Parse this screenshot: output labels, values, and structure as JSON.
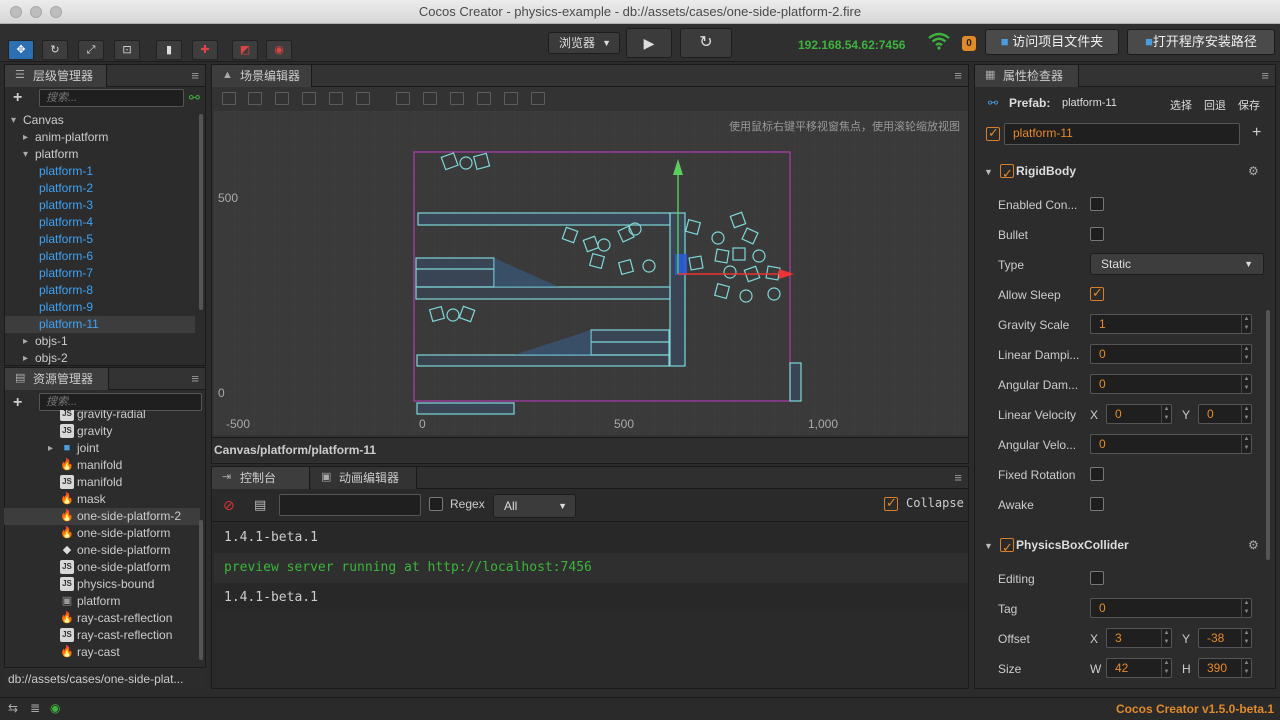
{
  "window": {
    "title": "Cocos Creator - physics-example - db://assets/cases/one-side-platform-2.fire"
  },
  "toolbar": {
    "browser_label": "浏览器",
    "ip": "192.168.54.62:7456",
    "badge": "0",
    "open_project_folder": "访问项目文件夹",
    "open_install_path": "打开程序安装路径"
  },
  "hierarchy": {
    "title": "层级管理器",
    "search_placeholder": "搜索...",
    "items": [
      {
        "label": "Canvas",
        "depth": 0,
        "arrow": "▾",
        "color": "#cccccc"
      },
      {
        "label": "anim-platform",
        "depth": 1,
        "arrow": "▸",
        "color": "#cccccc"
      },
      {
        "label": "platform",
        "depth": 1,
        "arrow": "▾",
        "color": "#cccccc"
      },
      {
        "label": "platform-1",
        "depth": 2,
        "arrow": "",
        "color": "#3ea2f5"
      },
      {
        "label": "platform-2",
        "depth": 2,
        "arrow": "",
        "color": "#3ea2f5"
      },
      {
        "label": "platform-3",
        "depth": 2,
        "arrow": "",
        "color": "#3ea2f5"
      },
      {
        "label": "platform-4",
        "depth": 2,
        "arrow": "",
        "color": "#3ea2f5"
      },
      {
        "label": "platform-5",
        "depth": 2,
        "arrow": "",
        "color": "#3ea2f5"
      },
      {
        "label": "platform-6",
        "depth": 2,
        "arrow": "",
        "color": "#3ea2f5"
      },
      {
        "label": "platform-7",
        "depth": 2,
        "arrow": "",
        "color": "#3ea2f5"
      },
      {
        "label": "platform-8",
        "depth": 2,
        "arrow": "",
        "color": "#3ea2f5"
      },
      {
        "label": "platform-9",
        "depth": 2,
        "arrow": "",
        "color": "#3ea2f5"
      },
      {
        "label": "platform-11",
        "depth": 2,
        "arrow": "",
        "color": "#3ea2f5",
        "selected": true
      },
      {
        "label": "objs-1",
        "depth": 1,
        "arrow": "▸",
        "color": "#cccccc"
      },
      {
        "label": "objs-2",
        "depth": 1,
        "arrow": "▸",
        "color": "#cccccc"
      }
    ]
  },
  "assets": {
    "title": "资源管理器",
    "search_placeholder": "搜索...",
    "path": "db://assets/cases/one-side-plat...",
    "items": [
      {
        "label": "gravity-radial",
        "icon": "js",
        "partial": true
      },
      {
        "label": "gravity",
        "icon": "js"
      },
      {
        "label": "joint",
        "icon": "folder",
        "arrow": "▸"
      },
      {
        "label": "manifold",
        "icon": "fire"
      },
      {
        "label": "manifold",
        "icon": "js"
      },
      {
        "label": "mask",
        "icon": "fire"
      },
      {
        "label": "one-side-platform-2",
        "icon": "fire",
        "selected": true
      },
      {
        "label": "one-side-platform",
        "icon": "fire"
      },
      {
        "label": "one-side-platform",
        "icon": "anim"
      },
      {
        "label": "one-side-platform",
        "icon": "js"
      },
      {
        "label": "physics-bound",
        "icon": "js"
      },
      {
        "label": "platform",
        "icon": "prefab"
      },
      {
        "label": "ray-cast-reflection",
        "icon": "fire"
      },
      {
        "label": "ray-cast-reflection",
        "icon": "js"
      },
      {
        "label": "ray-cast",
        "icon": "fire"
      }
    ]
  },
  "scene": {
    "title": "场景编辑器",
    "hint": "使用鼠标右键平移视窗焦点，使用滚轮缩放视图",
    "breadcrumb": "Canvas/platform/platform-11",
    "ruler_y": [
      "500",
      "0"
    ],
    "ruler_x": [
      "-500",
      "0",
      "500",
      "1,000"
    ]
  },
  "console": {
    "tab_console": "控制台",
    "tab_anim": "动画编辑器",
    "regex_label": "Regex",
    "filter_value": "All",
    "collapse_label": "Collapse",
    "lines": [
      {
        "text": "1.4.1-beta.1",
        "color": "#cccccc"
      },
      {
        "text": "preview server running at http://localhost:7456",
        "color": "#3ab53a"
      },
      {
        "text": "1.4.1-beta.1",
        "color": "#cccccc"
      }
    ]
  },
  "inspector": {
    "title": "属性检查器",
    "prefab_label": "Prefab:",
    "prefab_name": "platform-11",
    "select": "选择",
    "revert": "回退",
    "save": "保存",
    "node_name": "platform-11",
    "rigidbody": {
      "title": "RigidBody",
      "enabled_contact": "Enabled Con...",
      "bullet": "Bullet",
      "type_label": "Type",
      "type_value": "Static",
      "allow_sleep": "Allow Sleep",
      "gravity_scale": "Gravity Scale",
      "gravity_scale_value": "1",
      "linear_damping": "Linear Dampi...",
      "linear_damping_value": "0",
      "angular_damping": "Angular Dam...",
      "angular_damping_value": "0",
      "linear_velocity": "Linear Velocity",
      "lv_x_label": "X",
      "lv_x": "0",
      "lv_y_label": "Y",
      "lv_y": "0",
      "angular_velocity": "Angular Velo...",
      "angular_velocity_value": "0",
      "fixed_rotation": "Fixed Rotation",
      "awake": "Awake"
    },
    "boxcollider": {
      "title": "PhysicsBoxCollider",
      "editing": "Editing",
      "tag": "Tag",
      "tag_value": "0",
      "offset": "Offset",
      "off_x_label": "X",
      "off_x": "3",
      "off_y_label": "Y",
      "off_y": "-38",
      "size": "Size",
      "w_label": "W",
      "w": "42",
      "h_label": "H",
      "h": "390"
    }
  },
  "status": {
    "version": "Cocos Creator v1.5.0-beta.1"
  }
}
